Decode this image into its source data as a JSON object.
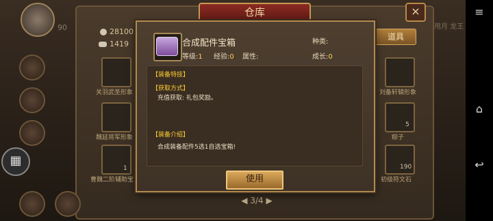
{
  "window": {
    "title": "仓库",
    "close_icon": "×"
  },
  "resources": {
    "coins": "28100",
    "ingots": "1419",
    "level_badge": "90"
  },
  "tabs": {
    "daoju": "道具",
    "right_partial": "甩月 龙王"
  },
  "slots": [
    {
      "label": "关羽武圣形象"
    },
    {
      "label": "魏延将军形象"
    },
    {
      "label": "曹魏二阶辅助宝"
    },
    {
      "label": "刘备轩辕形象"
    },
    {
      "label": "粽子",
      "count": "5"
    },
    {
      "label": "初级符文石",
      "count": "190"
    }
  ],
  "slot_counts": {
    "chest": "1"
  },
  "pager": "3/4",
  "item": {
    "name": "合成配件宝箱",
    "level_label": "等级:",
    "level_value": "1",
    "exp_label": "经验:",
    "exp_value": "0",
    "attr_label": "属性:",
    "type_label": "种类:",
    "growth_label": "成长:",
    "growth_value": "0"
  },
  "sections": {
    "skill_title": "【装备特技】",
    "obtain_title": "【获取方式】",
    "obtain_text": "充值获取: 礼包奖励。",
    "intro_title": "【装备介绍】",
    "intro_text": "合成装备配件5选1自选宝箱!"
  },
  "use_button": "使用",
  "system_nav": {
    "menu": "≡",
    "home": "⌂",
    "back": "↩"
  },
  "colors": {
    "gold_text": "#ffcc33",
    "value_yellow": "#ffce5a",
    "modal_border": "#b28a50"
  }
}
